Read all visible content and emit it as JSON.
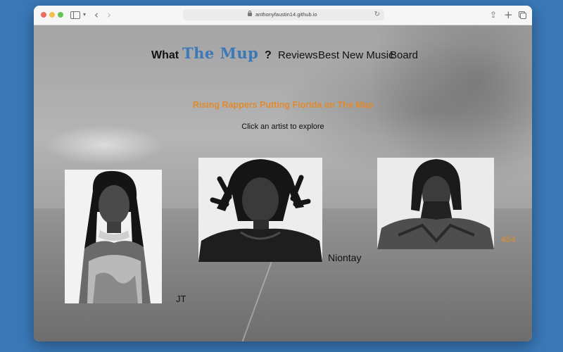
{
  "browser": {
    "url": "anthonyfaustin14.github.io"
  },
  "nav": {
    "what": "What",
    "logo": "The Mup",
    "question": "?",
    "reviews": "Reviews",
    "best_new_music": "Best New Music",
    "board": "Board"
  },
  "main": {
    "headline": "Rising Rappers Putting Florida on The Map",
    "subhead": "Click an artist to explore"
  },
  "artists": [
    {
      "name": "JT"
    },
    {
      "name": "Niontay"
    },
    {
      "name": "454"
    }
  ],
  "colors": {
    "accent": "#e08a2e",
    "logo": "#3a78b8",
    "desktop": "#3a78b8"
  },
  "icons": [
    "sidebar-icon",
    "chevron-down-icon",
    "back-icon",
    "forward-icon",
    "lock-icon",
    "reload-icon",
    "share-icon",
    "new-tab-icon",
    "tab-overview-icon"
  ]
}
